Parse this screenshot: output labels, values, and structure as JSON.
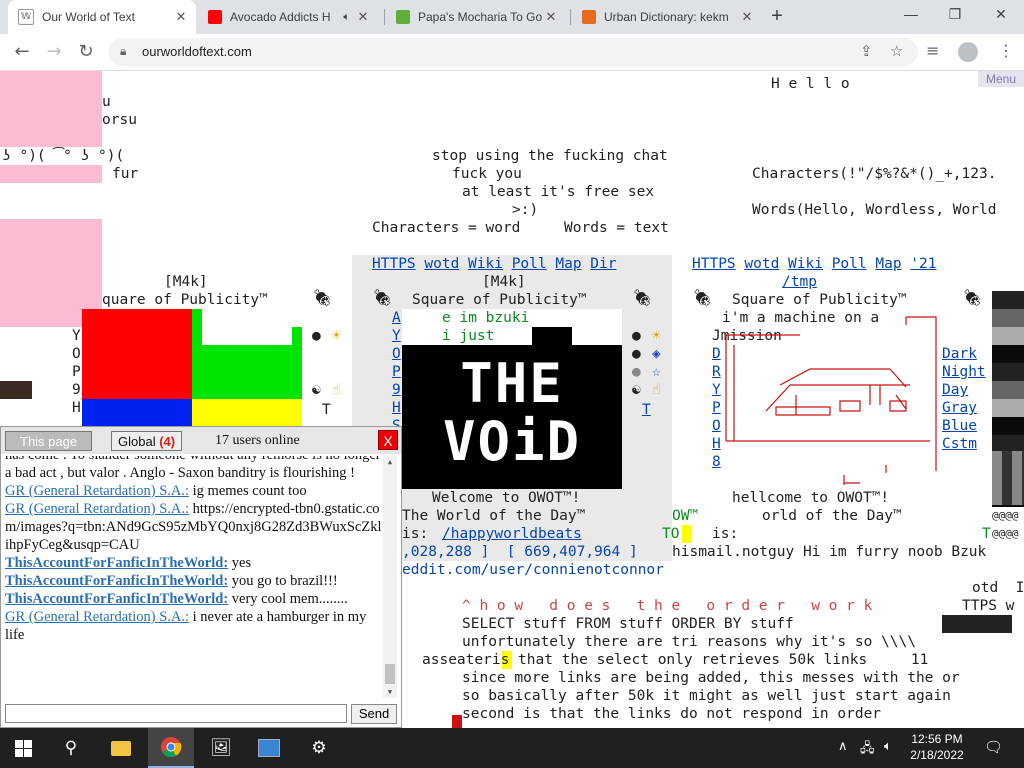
{
  "browser": {
    "tabs": [
      {
        "title": "Our World of Text",
        "active": true
      },
      {
        "title": "Avocado Addicts H",
        "active": false
      },
      {
        "title": "Papa's Mocharia To Go",
        "active": false
      },
      {
        "title": "Urban Dictionary: kekm",
        "active": false
      }
    ],
    "url": "ourworldoftext.com"
  },
  "page": {
    "menu_label": "Menu",
    "center_lines": [
      "stop using the fucking chat",
      "fuck you",
      "at least it's free sex",
      ">:)",
      "Characters = word     Words = text"
    ],
    "hello": "H e l l o",
    "characters": "Characters(!\"/$%?&*()_+,123.",
    "words": "Words(Hello, Wordless, World",
    "left_small": [
      "u",
      "orsu",
      "ʖ °)( ͡° ʖ °)(",
      "fur"
    ],
    "panel1": {
      "m4k": "[M4k]",
      "title": "quare of Publicity™"
    },
    "panel2": {
      "links": [
        "HTTPS",
        "wotd",
        "Wiki",
        "Poll",
        "Map",
        "Dir"
      ],
      "m4k": "[M4k]",
      "title": "Square of Publicity™",
      "lines": [
        "e im bzuki",
        "i just"
      ],
      "welcome": "Welcome to OWOT™!",
      "wotd_label": "The World of the Day™",
      "is_label": "is:",
      "wotd_link": "/happyworldbeats",
      "counts": ",028,288 ]  [ 669,407,964 ]",
      "reddit": "eddit.com/user/connienotconnor",
      "void_text": "THE VOiD"
    },
    "panel3": {
      "links": [
        "HTTPS",
        "wotd",
        "Wiki",
        "Poll",
        "Map",
        "'21"
      ],
      "tmp": "/tmp",
      "title": "Square of Publicity™",
      "machine": "i'm a machine on a",
      "mission": "Jmission",
      "themes": [
        "Dark",
        "Night",
        "Day",
        "Gray",
        "Blue",
        "Cstm"
      ],
      "welcome": "hellcome to OWOT™!",
      "wotd_label": "orld of the Day™",
      "is_label": "is:",
      "furry": "hismail.notguy Hi im furry noob Bzuk"
    },
    "order_lines": [
      "^ h o w   d o e s   t h e   o r d e r   w o r k",
      "SELECT stuff FROM stuff ORDER BY stuff",
      "unfortunately there are tri reasons why it's so \\\\\\\\",
      "asseateris that the select only retrieves 50k links     11",
      "since more links are being added, this messes with the or",
      "so basically after 50k it might as well just start again",
      "second is that the links do not respond in order"
    ],
    "right_bits": [
      "otd  I",
      "TTPS w"
    ]
  },
  "chat": {
    "tab_this_page": "This page",
    "tab_global": "Global",
    "global_count": "(4)",
    "online": "17 users online",
    "close": "X",
    "send": "Send",
    "messages": [
      {
        "user": "",
        "text": "has come . To slander someone without any remorse is no longer a bad act , but valor . Anglo - Saxon banditry is flourishing !",
        "bold": false
      },
      {
        "user": "GR (General Retardation) S.A.:",
        "text": " ig memes count too",
        "bold": false
      },
      {
        "user": "GR (General Retardation) S.A.:",
        "text": " https://encrypted-tbn0.gstatic.com/images?q=tbn:ANd9GcS95zMbYQ0nxj8G28Zd3BWuxScZklihpFyCeg&usqp=CAU",
        "bold": false
      },
      {
        "user": "ThisAccountForFanficInTheWorld:",
        "text": " yes",
        "bold": true
      },
      {
        "user": "ThisAccountForFanficInTheWorld:",
        "text": " you go to brazil!!!",
        "bold": true
      },
      {
        "user": "ThisAccountForFanficInTheWorld:",
        "text": " very cool mem........",
        "bold": true
      },
      {
        "user": "GR (General Retardation) S.A.:",
        "text": " i never ate a hamburger in my life",
        "bold": false
      }
    ]
  },
  "taskbar": {
    "time": "12:56 PM",
    "date": "2/18/2022"
  },
  "colors": {
    "chat_close": "#ee0000",
    "link": "#0645ad",
    "chat_user": "#2a6fb5"
  }
}
